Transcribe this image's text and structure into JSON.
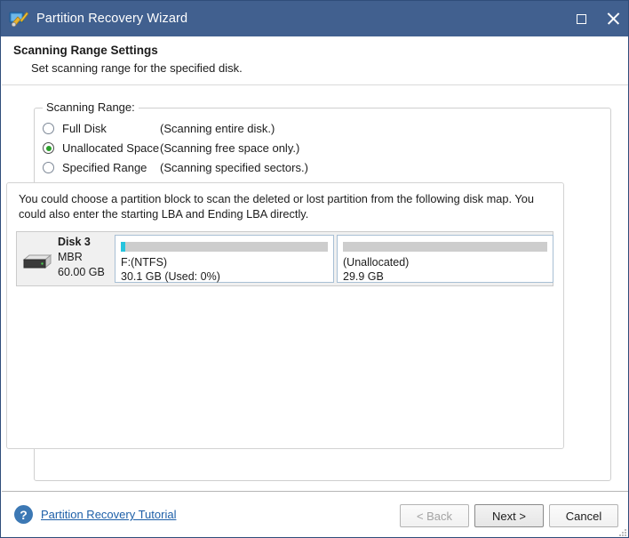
{
  "window": {
    "title": "Partition Recovery Wizard",
    "app_icon": "partition-wizard-icon",
    "controls": {
      "maximize": "maximize-icon",
      "close": "close-icon"
    }
  },
  "header": {
    "title": "Scanning Range Settings",
    "subtitle": "Set scanning range for the specified disk."
  },
  "groupbox": {
    "label": "Scanning Range:",
    "options": [
      {
        "label": "Full Disk",
        "hint": "(Scanning entire disk.)",
        "selected": false
      },
      {
        "label": "Unallocated Space",
        "hint": "(Scanning free space only.)",
        "selected": true
      },
      {
        "label": "Specified Range",
        "hint": "(Scanning specified sectors.)",
        "selected": false
      }
    ]
  },
  "disk_map": {
    "note": "You could choose a partition block to scan the deleted or lost partition from the following disk map. You could also enter the starting LBA and Ending LBA directly.",
    "disk": {
      "name": "Disk 3",
      "scheme": "MBR",
      "capacity": "60.00 GB",
      "icon": "hard-disk-icon"
    },
    "partitions": [
      {
        "title": "F:(NTFS)",
        "detail": "30.1 GB (Used: 0%)",
        "used_percent": 2,
        "bar_color": "#27c4dd",
        "bar_track_color": "#cdcdcd"
      },
      {
        "title": "(Unallocated)",
        "detail": "29.9 GB",
        "used_percent": 0,
        "bar_color": "#27c4dd",
        "bar_track_color": "#cdcdcd"
      }
    ]
  },
  "footer": {
    "help_icon": "question-mark-icon",
    "tutorial_link": "Partition Recovery Tutorial",
    "buttons": {
      "back": "< Back",
      "next": "Next >",
      "cancel": "Cancel"
    }
  },
  "colors": {
    "titlebar": "#41608f",
    "accent_link": "#1d5fa8",
    "radio_selected": "#2aa02a",
    "usage_bar": "#27c4dd"
  }
}
